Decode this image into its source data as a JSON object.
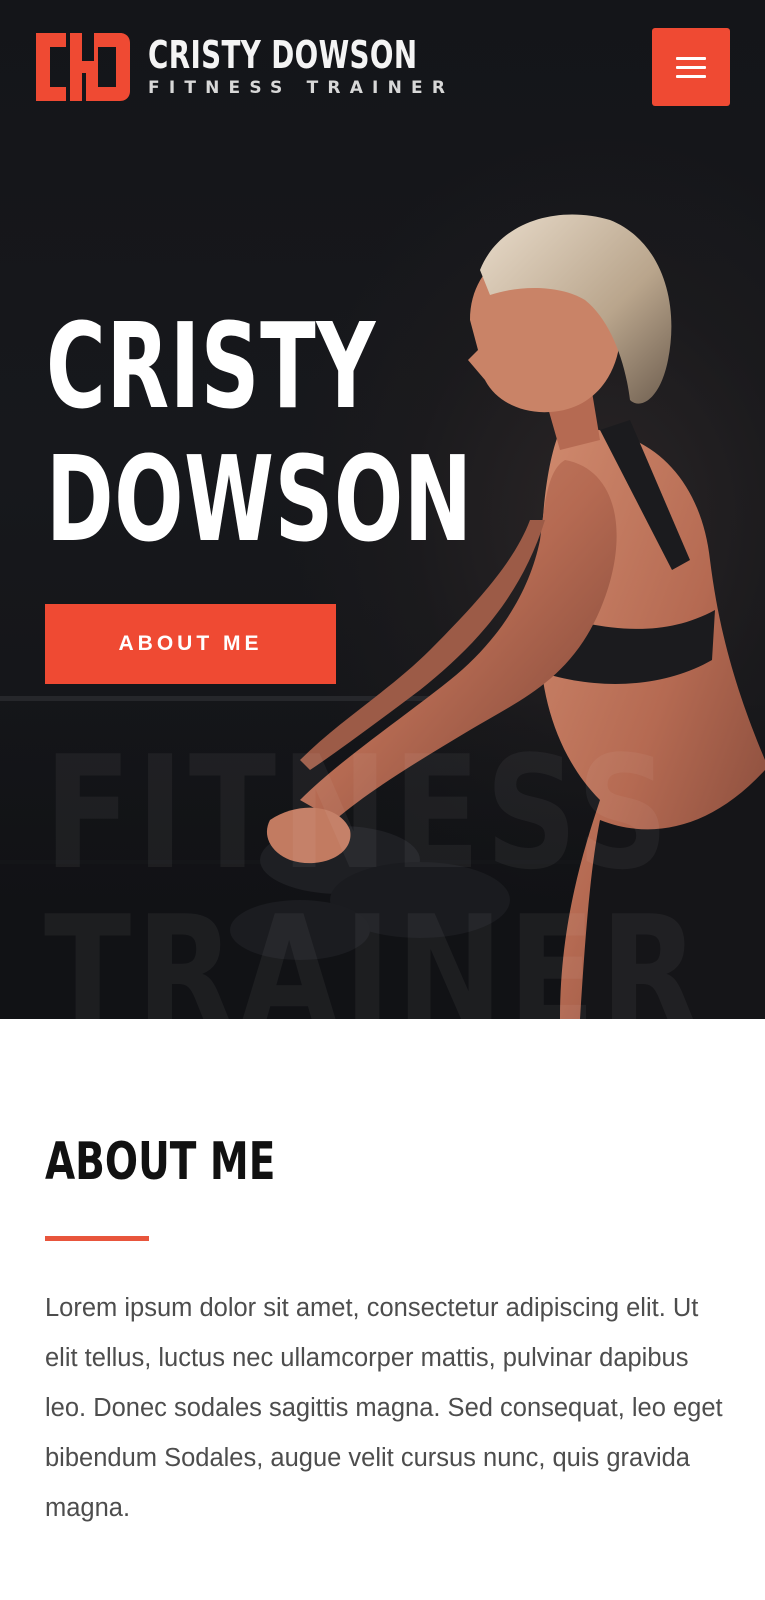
{
  "header": {
    "logo_monogram": "CHD",
    "logo_name": "CRISTY DOWSON",
    "logo_tagline": "FITNESS TRAINER",
    "menu_icon": "hamburger-menu-icon"
  },
  "hero": {
    "title_line1": "CRISTY",
    "title_line2": "DOWSON",
    "cta_label": "ABOUT ME",
    "watermark_line1": "FITNESS",
    "watermark_line2": "TRAINER"
  },
  "about": {
    "heading": "ABOUT ME",
    "body": "Lorem ipsum dolor sit amet, consectetur adipiscing elit. Ut elit tellus, luctus nec ullamcorper mattis, pulvinar dapibus leo. Donec sodales sagittis magna. Sed consequat, leo eget bibendum Sodales, augue velit cursus nunc, quis gravida magna."
  },
  "colors": {
    "accent": "#ef4a33",
    "hero_background": "#141519",
    "heading_text": "#111111",
    "body_text": "#4d4d4d"
  }
}
